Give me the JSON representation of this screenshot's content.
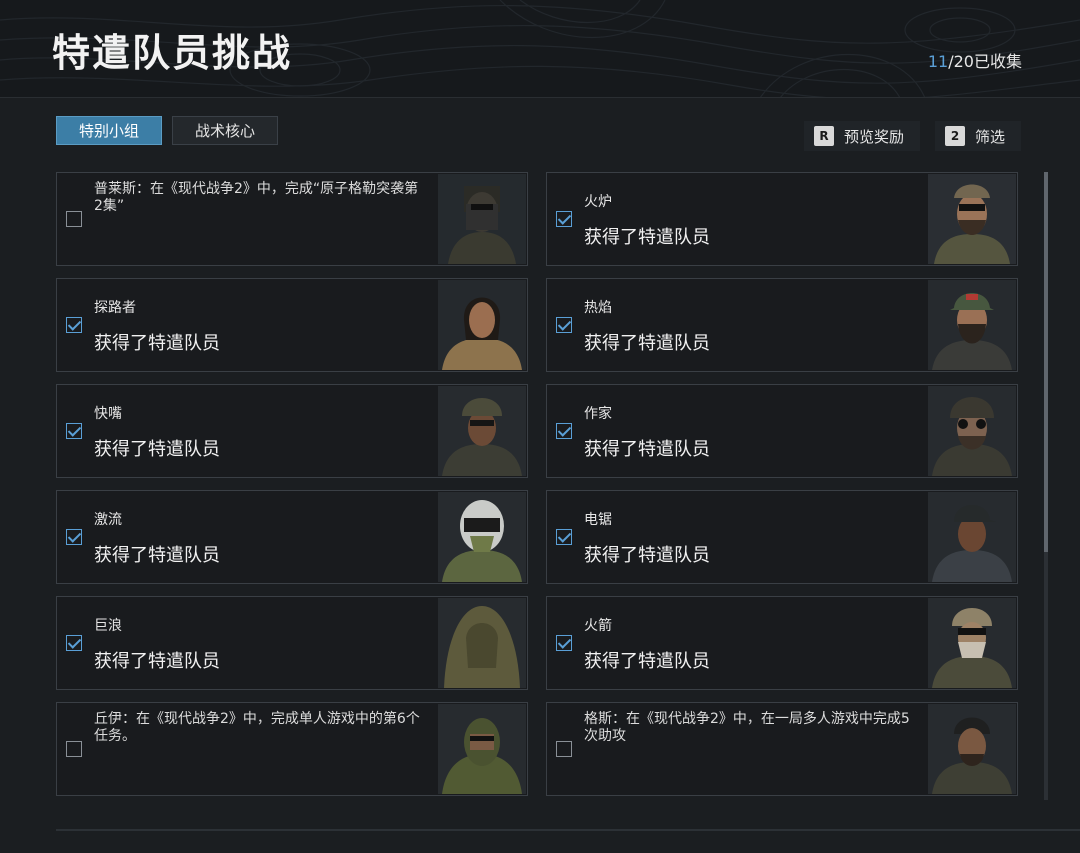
{
  "header": {
    "title": "特遣队员挑战",
    "collect_count": "11",
    "collect_suffix": "/20已收集"
  },
  "tabs": [
    {
      "label": "特别小组",
      "active": true
    },
    {
      "label": "战术核心",
      "active": false
    }
  ],
  "actions": [
    {
      "key": "R",
      "label": "预览奖励"
    },
    {
      "key": "2",
      "label": "筛选"
    }
  ],
  "cards": [
    {
      "id": "prices",
      "locked": true,
      "checked": false,
      "desc": "普莱斯：在《现代战争2》中，完成“原子格勒突袭第2集”",
      "portrait": "price-icon"
    },
    {
      "id": "furnace",
      "locked": false,
      "checked": true,
      "name": "火炉",
      "status": "获得了特遣队员",
      "portrait": "furnace-icon"
    },
    {
      "id": "pathfinder",
      "locked": false,
      "checked": true,
      "name": "探路者",
      "status": "获得了特遣队员",
      "portrait": "pathfinder-icon"
    },
    {
      "id": "blaze",
      "locked": false,
      "checked": true,
      "name": "热焰",
      "status": "获得了特遣队员",
      "portrait": "blaze-icon"
    },
    {
      "id": "quickmouth",
      "locked": false,
      "checked": true,
      "name": "快嘴",
      "status": "获得了特遣队员",
      "portrait": "quickmouth-icon"
    },
    {
      "id": "writer",
      "locked": false,
      "checked": true,
      "name": "作家",
      "status": "获得了特遣队员",
      "portrait": "writer-icon"
    },
    {
      "id": "torrent",
      "locked": false,
      "checked": true,
      "name": "激流",
      "status": "获得了特遣队员",
      "portrait": "torrent-icon"
    },
    {
      "id": "chainsaw",
      "locked": false,
      "checked": true,
      "name": "电锯",
      "status": "获得了特遣队员",
      "portrait": "chainsaw-icon"
    },
    {
      "id": "wave",
      "locked": false,
      "checked": true,
      "name": "巨浪",
      "status": "获得了特遣队员",
      "portrait": "wave-icon"
    },
    {
      "id": "rocket",
      "locked": false,
      "checked": true,
      "name": "火箭",
      "status": "获得了特遣队员",
      "portrait": "rocket-icon"
    },
    {
      "id": "qiuyi",
      "locked": true,
      "checked": false,
      "desc": "丘伊：在《现代战争2》中，完成单人游戏中的第6个任务。",
      "portrait": "qiuyi-icon"
    },
    {
      "id": "gaz",
      "locked": true,
      "checked": false,
      "desc": "格斯：在《现代战争2》中，在一局多人游戏中完成5次助攻",
      "portrait": "gaz-icon"
    }
  ],
  "colors": {
    "accent": "#5a9fd6",
    "tab_active": "#3c7ea6"
  }
}
